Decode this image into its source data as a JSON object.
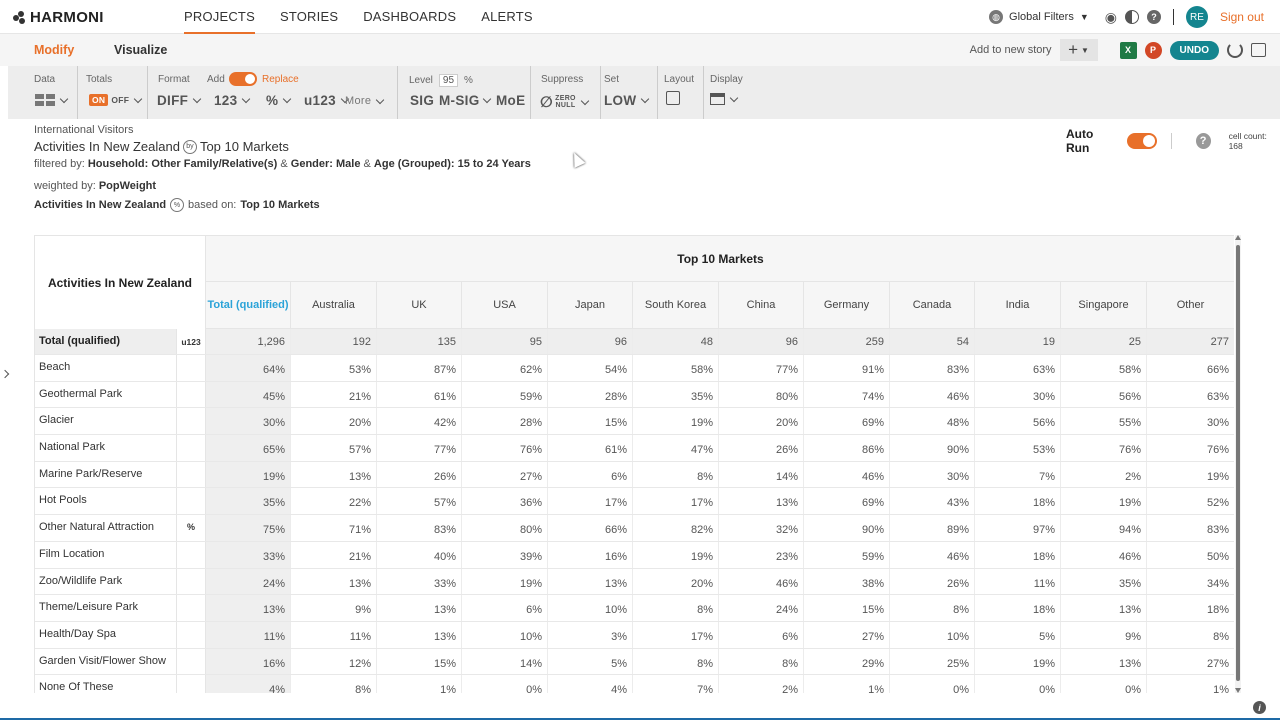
{
  "app": {
    "logo": "HARMONI"
  },
  "nav": {
    "items": [
      "PROJECTS",
      "STORIES",
      "DASHBOARDS",
      "ALERTS"
    ],
    "active": "PROJECTS"
  },
  "topRight": {
    "globalFilters": "Global Filters",
    "avatar": "RE",
    "signOut": "Sign out"
  },
  "modbar": {
    "modify": "Modify",
    "visualize": "Visualize",
    "addToStory": "Add to new story",
    "undo": "UNDO",
    "excel": "X",
    "ppt": "P"
  },
  "toolbar": {
    "data": "Data",
    "totals": "Totals",
    "on": "ON",
    "off": "OFF",
    "format": "Format",
    "formatValue": "DIFF",
    "add": "Add",
    "replace": "Replace",
    "addValues": [
      "123",
      "%",
      "u123",
      "More"
    ],
    "level": "Level",
    "levelValue": "95",
    "levelPct": "%",
    "levelValues": [
      "SIG",
      "M-SIG",
      "MoE"
    ],
    "suppress": "Suppress",
    "zero": "ZERO",
    "null": "NULL",
    "set": "Set",
    "setValue": "LOW",
    "layout": "Layout",
    "display": "Display"
  },
  "titles": {
    "dataset": "International Visitors",
    "rowVar": "Activities In New Zealand",
    "by": "by",
    "colVar": "Top 10 Markets",
    "filterPrefix": "filtered by:",
    "filter1": "Household: Other Family/Relative(s)",
    "filter2": "Gender: Male",
    "filter3": "Age (Grouped): 15 to 24 Years",
    "amp": "&",
    "weightPrefix": "weighted by:",
    "weight": "PopWeight",
    "basedRow": "Activities In New Zealand",
    "pctBadge": "%",
    "basedOn": "based on:",
    "basedCol": "Top 10 Markets"
  },
  "autorun": {
    "label": "Auto Run",
    "cellCount": "cell count: 168"
  },
  "table": {
    "cornerLabel": "Activities In New Zealand",
    "banner": "Top 10 Markets",
    "columns": [
      "Total (qualified)",
      "Australia",
      "UK",
      "USA",
      "Japan",
      "South Korea",
      "China",
      "Germany",
      "Canada",
      "India",
      "Singapore",
      "Other"
    ],
    "totalRow": {
      "label": "Total (qualified)",
      "stat": "u123",
      "values": [
        "1,296",
        "192",
        "135",
        "95",
        "96",
        "48",
        "96",
        "259",
        "54",
        "19",
        "25",
        "277"
      ]
    },
    "pctStat": "%",
    "rows": [
      {
        "label": "Beach",
        "values": [
          "64%",
          "53%",
          "87%",
          "62%",
          "54%",
          "58%",
          "77%",
          "91%",
          "83%",
          "63%",
          "58%",
          "66%"
        ]
      },
      {
        "label": "Geothermal Park",
        "values": [
          "45%",
          "21%",
          "61%",
          "59%",
          "28%",
          "35%",
          "80%",
          "74%",
          "46%",
          "30%",
          "56%",
          "63%"
        ]
      },
      {
        "label": "Glacier",
        "values": [
          "30%",
          "20%",
          "42%",
          "28%",
          "15%",
          "19%",
          "20%",
          "69%",
          "48%",
          "56%",
          "55%",
          "30%"
        ]
      },
      {
        "label": "National Park",
        "values": [
          "65%",
          "57%",
          "77%",
          "76%",
          "61%",
          "47%",
          "26%",
          "86%",
          "90%",
          "53%",
          "76%",
          "76%"
        ]
      },
      {
        "label": "Marine Park/Reserve",
        "values": [
          "19%",
          "13%",
          "26%",
          "27%",
          "6%",
          "8%",
          "14%",
          "46%",
          "30%",
          "7%",
          "2%",
          "19%"
        ]
      },
      {
        "label": "Hot Pools",
        "values": [
          "35%",
          "22%",
          "57%",
          "36%",
          "17%",
          "17%",
          "13%",
          "69%",
          "43%",
          "18%",
          "19%",
          "52%"
        ]
      },
      {
        "label": "Other Natural Attraction",
        "values": [
          "75%",
          "71%",
          "83%",
          "80%",
          "66%",
          "82%",
          "32%",
          "90%",
          "89%",
          "97%",
          "94%",
          "83%"
        ]
      },
      {
        "label": "Film Location",
        "values": [
          "33%",
          "21%",
          "40%",
          "39%",
          "16%",
          "19%",
          "23%",
          "59%",
          "46%",
          "18%",
          "46%",
          "50%"
        ]
      },
      {
        "label": "Zoo/Wildlife Park",
        "values": [
          "24%",
          "13%",
          "33%",
          "19%",
          "13%",
          "20%",
          "46%",
          "38%",
          "26%",
          "11%",
          "35%",
          "34%"
        ]
      },
      {
        "label": "Theme/Leisure Park",
        "values": [
          "13%",
          "9%",
          "13%",
          "6%",
          "10%",
          "8%",
          "24%",
          "15%",
          "8%",
          "18%",
          "13%",
          "18%"
        ]
      },
      {
        "label": "Health/Day Spa",
        "values": [
          "11%",
          "11%",
          "13%",
          "10%",
          "3%",
          "17%",
          "6%",
          "27%",
          "10%",
          "5%",
          "9%",
          "8%"
        ]
      },
      {
        "label": "Garden Visit/Flower Show",
        "values": [
          "16%",
          "12%",
          "15%",
          "14%",
          "5%",
          "8%",
          "8%",
          "29%",
          "25%",
          "19%",
          "13%",
          "27%"
        ]
      },
      {
        "label": "None Of These",
        "values": [
          "4%",
          "8%",
          "1%",
          "0%",
          "4%",
          "7%",
          "2%",
          "1%",
          "0%",
          "0%",
          "0%",
          "1%"
        ]
      }
    ]
  }
}
